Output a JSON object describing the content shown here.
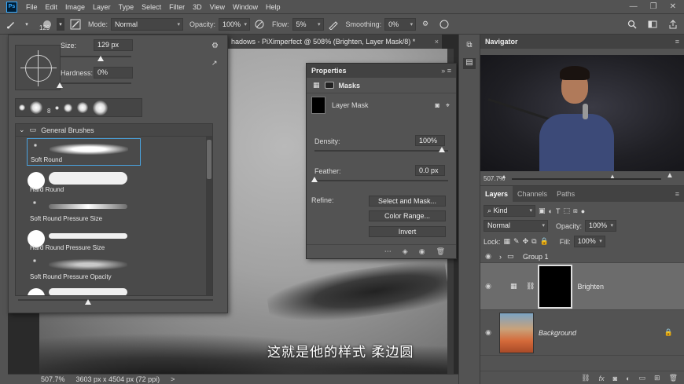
{
  "menubar": {
    "logo": "Ps",
    "items": [
      "File",
      "Edit",
      "Image",
      "Layer",
      "Type",
      "Select",
      "Filter",
      "3D",
      "View",
      "Window",
      "Help"
    ],
    "window_controls": [
      "—",
      "❐",
      "✕"
    ]
  },
  "options": {
    "brush_size": "129",
    "mode_label": "Mode:",
    "mode_value": "Normal",
    "opacity_label": "Opacity:",
    "opacity_value": "100%",
    "flow_label": "Flow:",
    "flow_value": "5%",
    "smoothing_label": "Smoothing:",
    "smoothing_value": "0%"
  },
  "document": {
    "tab_title": "hadows - PiXimperfect @ 508% (Brighten, Layer Mask/8) *",
    "close": "×",
    "subtitle": "这就是他的样式 柔边圆"
  },
  "status": {
    "zoom": "507.7%",
    "dimensions": "3603 px x 4504 px (72 ppi)",
    "arrow": ">"
  },
  "brush_picker": {
    "size_label": "Size:",
    "size_value": "129 px",
    "hardness_label": "Hardness:",
    "hardness_value": "0%",
    "recent_size": "8",
    "folder": "General Brushes",
    "brushes": [
      {
        "name": "Soft Round"
      },
      {
        "name": "Hard Round"
      },
      {
        "name": "Soft Round Pressure Size"
      },
      {
        "name": "Hard Round Pressure Size"
      },
      {
        "name": "Soft Round Pressure Opacity"
      }
    ]
  },
  "properties": {
    "title": "Properties",
    "section": "Masks",
    "mask_label": "Layer Mask",
    "density_label": "Density:",
    "density_value": "100%",
    "feather_label": "Feather:",
    "feather_value": "0.0 px",
    "refine_label": "Refine:",
    "select_and_mask": "Select and Mask...",
    "color_range": "Color Range...",
    "invert": "Invert"
  },
  "navigator": {
    "title": "Navigator",
    "zoom": "507.7%"
  },
  "layers": {
    "tabs": [
      "Layers",
      "Channels",
      "Paths"
    ],
    "kind": "Kind",
    "blend_mode": "Normal",
    "opacity_label": "Opacity:",
    "opacity_value": "100%",
    "lock_label": "Lock:",
    "fill_label": "Fill:",
    "fill_value": "100%",
    "group_name": "Group 1",
    "brighten_name": "Brighten",
    "background_name": "Background"
  },
  "colors": {
    "ui_bg": "#535353",
    "panel_header": "#424242",
    "accent": "#31a8ff",
    "selected_layer": "#6c6c6c"
  }
}
